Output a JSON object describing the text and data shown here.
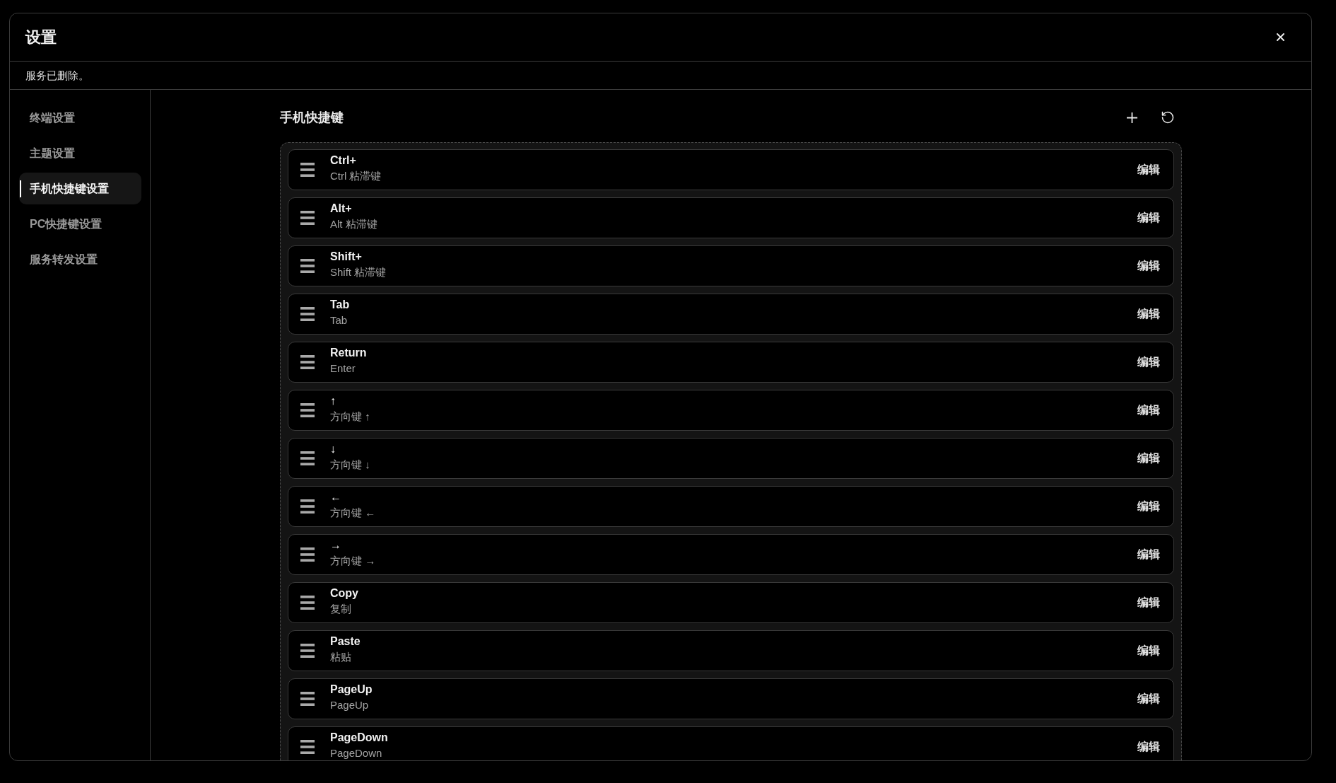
{
  "dialog": {
    "title": "设置"
  },
  "notice": "服务已删除。",
  "sidebar": {
    "items": [
      {
        "label": "终端设置",
        "selected": false
      },
      {
        "label": "主题设置",
        "selected": false
      },
      {
        "label": "手机快捷键设置",
        "selected": true
      },
      {
        "label": "PC快捷键设置",
        "selected": false
      },
      {
        "label": "服务转发设置",
        "selected": false
      }
    ]
  },
  "section": {
    "title": "手机快捷键"
  },
  "shortcuts": [
    {
      "name": "Ctrl+",
      "description": "Ctrl 粘滞键",
      "action": "编辑"
    },
    {
      "name": "Alt+",
      "description": "Alt 粘滞键",
      "action": "编辑"
    },
    {
      "name": "Shift+",
      "description": "Shift 粘滞键",
      "action": "编辑"
    },
    {
      "name": "Tab",
      "description": "Tab",
      "action": "编辑"
    },
    {
      "name": "Return",
      "description": "Enter",
      "action": "编辑"
    },
    {
      "name": "↑",
      "description": "方向键 ↑",
      "action": "编辑"
    },
    {
      "name": "↓",
      "description": "方向键 ↓",
      "action": "编辑"
    },
    {
      "name": "←",
      "description": "方向键 ←",
      "action": "编辑"
    },
    {
      "name": "→",
      "description": "方向键 →",
      "action": "编辑"
    },
    {
      "name": "Copy",
      "description": "复制",
      "action": "编辑"
    },
    {
      "name": "Paste",
      "description": "粘贴",
      "action": "编辑"
    },
    {
      "name": "PageUp",
      "description": "PageUp",
      "action": "编辑"
    },
    {
      "name": "PageDown",
      "description": "PageDown",
      "action": "编辑"
    }
  ]
}
